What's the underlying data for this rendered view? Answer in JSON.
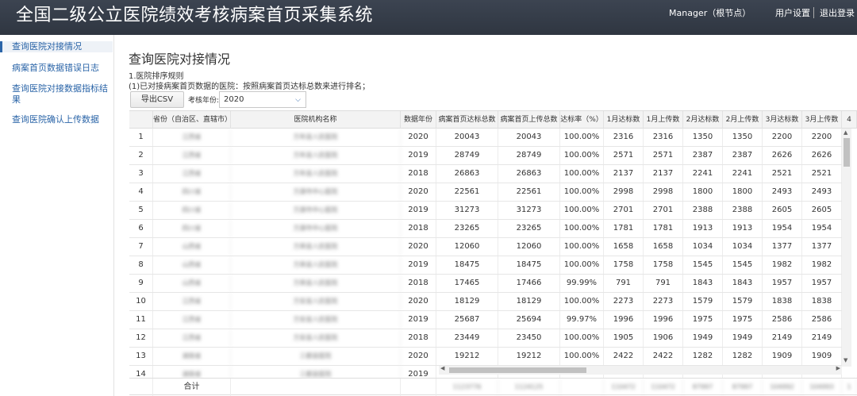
{
  "header": {
    "title": "全国二级公立医院绩效考核病案首页采集系统",
    "user": "Manager（根节点）",
    "settings": "用户设置",
    "logout": "退出登录"
  },
  "sidebar": {
    "items": [
      {
        "label": "查询医院对接情况"
      },
      {
        "label": "病案首页数据错误日志"
      },
      {
        "label": "查询医院对接数据指标结果"
      },
      {
        "label": "查询医院确认上传数据"
      }
    ]
  },
  "main": {
    "title": "查询医院对接情况",
    "rule1": "1.医院排序规则",
    "rule2": "(1)已对接病案首页数据的医院：按照病案首页达标总数来进行排名；",
    "export_label": "导出CSV",
    "year_label": "考核年份:",
    "year_value": "2020"
  },
  "table": {
    "columns": [
      "",
      "省份（自治区、直辖市）",
      "医院机构名称",
      "数据年份",
      "病案首页达标总数",
      "病案首页上传总数",
      "达标率（%）",
      "1月达标数",
      "1月上传数",
      "2月达标数",
      "2月上传数",
      "3月达标数",
      "3月上传数",
      "4"
    ],
    "rows": [
      [
        "1",
        "江西省",
        "万年县人民医院",
        "2020",
        "20043",
        "20043",
        "100.00%",
        "2316",
        "2316",
        "1350",
        "1350",
        "2200",
        "2200"
      ],
      [
        "2",
        "江西省",
        "万年县人民医院",
        "2019",
        "28749",
        "28749",
        "100.00%",
        "2571",
        "2571",
        "2387",
        "2387",
        "2626",
        "2626"
      ],
      [
        "3",
        "江西省",
        "万年县人民医院",
        "2018",
        "26863",
        "26863",
        "100.00%",
        "2137",
        "2137",
        "2241",
        "2241",
        "2521",
        "2521"
      ],
      [
        "4",
        "四川省",
        "万源市中心医院",
        "2020",
        "22561",
        "22561",
        "100.00%",
        "2998",
        "2998",
        "1800",
        "1800",
        "2493",
        "2493"
      ],
      [
        "5",
        "四川省",
        "万源市中心医院",
        "2019",
        "31273",
        "31273",
        "100.00%",
        "2701",
        "2701",
        "2388",
        "2388",
        "2605",
        "2605"
      ],
      [
        "6",
        "四川省",
        "万源市中心医院",
        "2018",
        "23265",
        "23265",
        "100.00%",
        "1781",
        "1781",
        "1913",
        "1913",
        "1954",
        "1954"
      ],
      [
        "7",
        "山西省",
        "万荣县人民医院",
        "2020",
        "12060",
        "12060",
        "100.00%",
        "1658",
        "1658",
        "1034",
        "1034",
        "1377",
        "1377"
      ],
      [
        "8",
        "山西省",
        "万荣县人民医院",
        "2019",
        "18475",
        "18475",
        "100.00%",
        "1758",
        "1758",
        "1545",
        "1545",
        "1982",
        "1982"
      ],
      [
        "9",
        "山西省",
        "万荣县人民医院",
        "2018",
        "17465",
        "17466",
        "99.99%",
        "791",
        "791",
        "1843",
        "1843",
        "1957",
        "1957"
      ],
      [
        "10",
        "江西省",
        "万安县人民医院",
        "2020",
        "18129",
        "18129",
        "100.00%",
        "2273",
        "2273",
        "1579",
        "1579",
        "1838",
        "1838"
      ],
      [
        "11",
        "江西省",
        "万安县人民医院",
        "2019",
        "25687",
        "25694",
        "99.97%",
        "1996",
        "1996",
        "1975",
        "1975",
        "2586",
        "2586"
      ],
      [
        "12",
        "江西省",
        "万安县人民医院",
        "2018",
        "23449",
        "23450",
        "100.00%",
        "1905",
        "1906",
        "1949",
        "1949",
        "2149",
        "2149"
      ],
      [
        "13",
        "湖南省",
        "三都县医院",
        "2020",
        "19212",
        "19212",
        "100.00%",
        "2422",
        "2422",
        "1282",
        "1282",
        "1909",
        "1909"
      ],
      [
        "14",
        "湖南省",
        "三都县医院",
        "2019",
        "",
        "",
        "",
        "",
        "",
        "",
        "",
        "",
        ""
      ]
    ],
    "footer": [
      "",
      "合计",
      "",
      "",
      "1123776",
      "1124125",
      "",
      "110472",
      "110472",
      "87997",
      "87997",
      "104992",
      "104993",
      "1"
    ]
  }
}
